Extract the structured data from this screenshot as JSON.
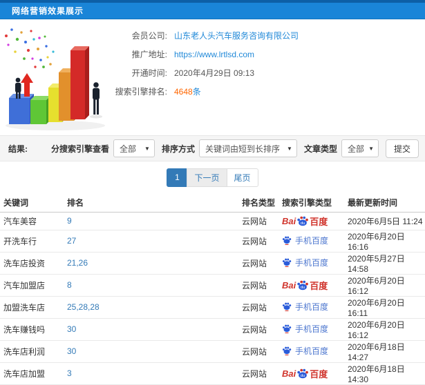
{
  "header": {
    "title": "网络营销效果展示"
  },
  "info": {
    "fields": [
      {
        "label": "会员公司:",
        "value": "山东老人头汽车服务咨询有限公司"
      },
      {
        "label": "推广地址:",
        "value": "https://www.lrtlsd.com"
      },
      {
        "label": "开通时间:",
        "value": "2020年4月29日 09:13"
      },
      {
        "label": "搜索引擎排名:",
        "value": "4648",
        "suffix": "条"
      }
    ]
  },
  "filters": {
    "result_label": "结果:",
    "engine_label": "分搜索引擎查看",
    "engine_value": "全部",
    "sort_label": "排序方式",
    "sort_value": "关键词由短到长排序",
    "article_label": "文章类型",
    "article_value": "全部",
    "submit_label": "提交"
  },
  "pagination": {
    "current": "1",
    "next_label": "下一页",
    "last_label": "尾页"
  },
  "table": {
    "headers": [
      "关键词",
      "排名",
      "排名类型",
      "搜索引擎类型",
      "最新更新时间"
    ],
    "rows": [
      {
        "keyword": "汽车美容",
        "rank": "9",
        "rank_type": "云网站",
        "engine": "baidu",
        "updated": "2020年6月5日 11:24"
      },
      {
        "keyword": "开洗车行",
        "rank": "27",
        "rank_type": "云网站",
        "engine": "mobile",
        "updated": "2020年6月20日 16:16"
      },
      {
        "keyword": "洗车店投资",
        "rank": "21,26",
        "rank_type": "云网站",
        "engine": "mobile",
        "updated": "2020年5月27日 14:58"
      },
      {
        "keyword": "汽车加盟店",
        "rank": "8",
        "rank_type": "云网站",
        "engine": "baidu",
        "updated": "2020年6月20日 16:12"
      },
      {
        "keyword": "加盟洗车店",
        "rank": "25,28,28",
        "rank_type": "云网站",
        "engine": "mobile",
        "updated": "2020年6月20日 16:11"
      },
      {
        "keyword": "洗车赚钱吗",
        "rank": "30",
        "rank_type": "云网站",
        "engine": "mobile",
        "updated": "2020年6月20日 16:12"
      },
      {
        "keyword": "洗车店利润",
        "rank": "30",
        "rank_type": "云网站",
        "engine": "mobile",
        "updated": "2020年6月18日 14:27"
      },
      {
        "keyword": "洗车店加盟",
        "rank": "3",
        "rank_type": "云网站",
        "engine": "baidu",
        "updated": "2020年6月18日 14:30"
      }
    ]
  },
  "engines": {
    "baidu": {
      "text_prefix": "Bai",
      "paw_text": "du",
      "text_suffix": "百度"
    },
    "mobile_baidu": {
      "label": "手机百度"
    }
  },
  "icons": {
    "dropdown_arrow": "▼"
  },
  "colors": {
    "header_blue": "#1a85d8",
    "header_dark_blue": "#0d5fa6",
    "link_blue": "#2189d8",
    "rank_count_orange": "#ff6600",
    "pagination_blue": "#337ab7",
    "baidu_red": "#d0342c",
    "baidu_blue": "#2b5cd9"
  }
}
